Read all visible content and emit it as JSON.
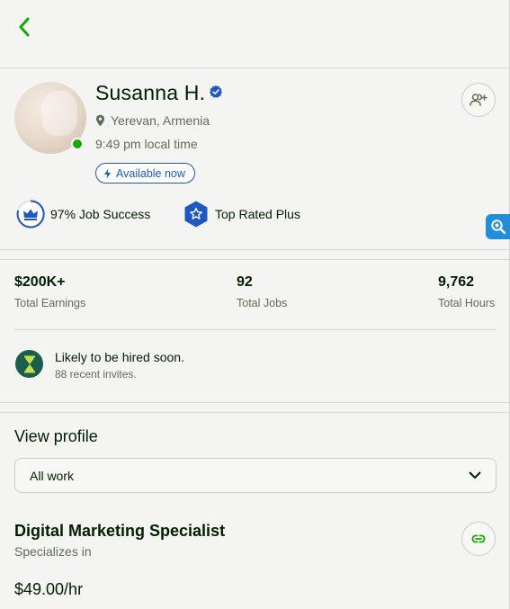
{
  "profile": {
    "name": "Susanna H.",
    "location": "Yerevan, Armenia",
    "local_time": "9:49 pm local time",
    "availability": "Available now",
    "job_success": "97% Job Success",
    "top_rated": "Top Rated Plus"
  },
  "stats": {
    "earnings": {
      "value": "$200K+",
      "label": "Total Earnings"
    },
    "jobs": {
      "value": "92",
      "label": "Total Jobs"
    },
    "hours": {
      "value": "9,762",
      "label": "Total Hours"
    }
  },
  "hire": {
    "title": "Likely to be hired soon.",
    "subtitle": "88 recent invites."
  },
  "view_profile": {
    "title": "View profile",
    "selected": "All work"
  },
  "specialty": {
    "title": "Digital Marketing Specialist",
    "subtitle": "Specializes in",
    "rate": "$49.00/hr"
  },
  "colors": {
    "brand_green": "#14a800",
    "verified_blue": "#1f57c3",
    "text_dark": "#001e00",
    "text_muted": "#5e6d55",
    "hire_icon_bg": "#1b5e4d"
  },
  "icons": {
    "back": "chevron-left-icon",
    "verified": "verified-badge-icon",
    "location": "map-pin-icon",
    "availability": "lightning-icon",
    "follow": "add-user-icon",
    "job_success": "crown-icon",
    "top_rated": "star-shield-icon",
    "side_tool": "search-zoom-icon",
    "hire": "hourglass-icon",
    "select": "chevron-down-icon",
    "link": "link-icon"
  }
}
